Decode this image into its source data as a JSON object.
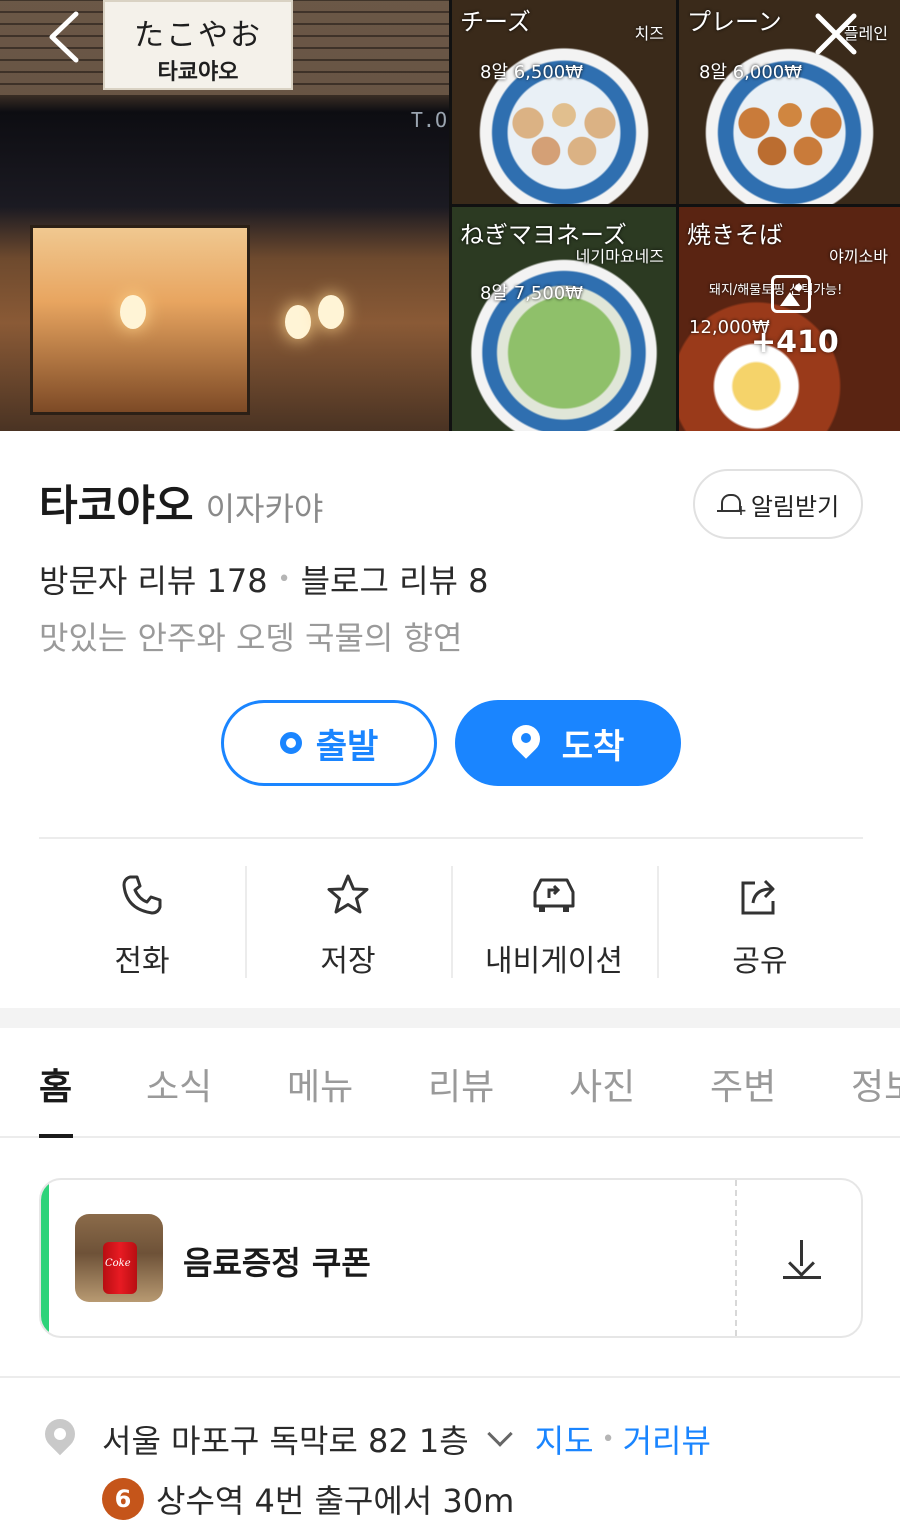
{
  "gallery": {
    "sign_logo": "たこやお",
    "sign_name": "타쿄야오",
    "storefront_text": "T.O",
    "photos": [
      {
        "jp": "チーズ",
        "ko": "치즈",
        "price": "8알 6,500₩"
      },
      {
        "jp": "プレーン",
        "ko": "플레인",
        "price": "8알 6,000₩"
      },
      {
        "jp": "ねぎマヨネーズ",
        "ko": "네기마요네즈",
        "price": "8알 7,500₩"
      },
      {
        "jp": "焼きそば",
        "ko": "야끼소바",
        "note": "돼지/해물토핑 선택가능!",
        "price": "12,000₩"
      }
    ],
    "more_count": "+410"
  },
  "header": {
    "back_icon": "chevron-left-icon",
    "close_icon": "close-icon"
  },
  "place": {
    "name": "타코야오",
    "category": "이자카야",
    "alert_label": "알림받기",
    "visitor_reviews": "방문자 리뷰 178",
    "blog_reviews": "블로그 리뷰 8",
    "tagline": "맛있는 안주와 오뎅 국물의 향연"
  },
  "route": {
    "depart_label": "출발",
    "arrive_label": "도착",
    "accent": "#1a85ff"
  },
  "actions": [
    {
      "label": "전화",
      "icon": "phone-icon"
    },
    {
      "label": "저장",
      "icon": "star-icon"
    },
    {
      "label": "내비게이션",
      "icon": "car-navigation-icon"
    },
    {
      "label": "공유",
      "icon": "share-icon"
    }
  ],
  "tabs": [
    {
      "label": "홈",
      "active": true
    },
    {
      "label": "소식"
    },
    {
      "label": "메뉴"
    },
    {
      "label": "리뷰"
    },
    {
      "label": "사진"
    },
    {
      "label": "주변"
    },
    {
      "label": "정보"
    }
  ],
  "coupon": {
    "title": "음료증정 쿠폰",
    "accent": "#2ed37a",
    "download_icon": "download-icon"
  },
  "location": {
    "address": "서울 마포구 독막로 82 1층",
    "map_link": "지도",
    "street_view_link": "거리뷰",
    "subway_line": "6",
    "subway_line_color": "#c5551a",
    "subway_text": "상수역 4번 출구에서 30m"
  }
}
